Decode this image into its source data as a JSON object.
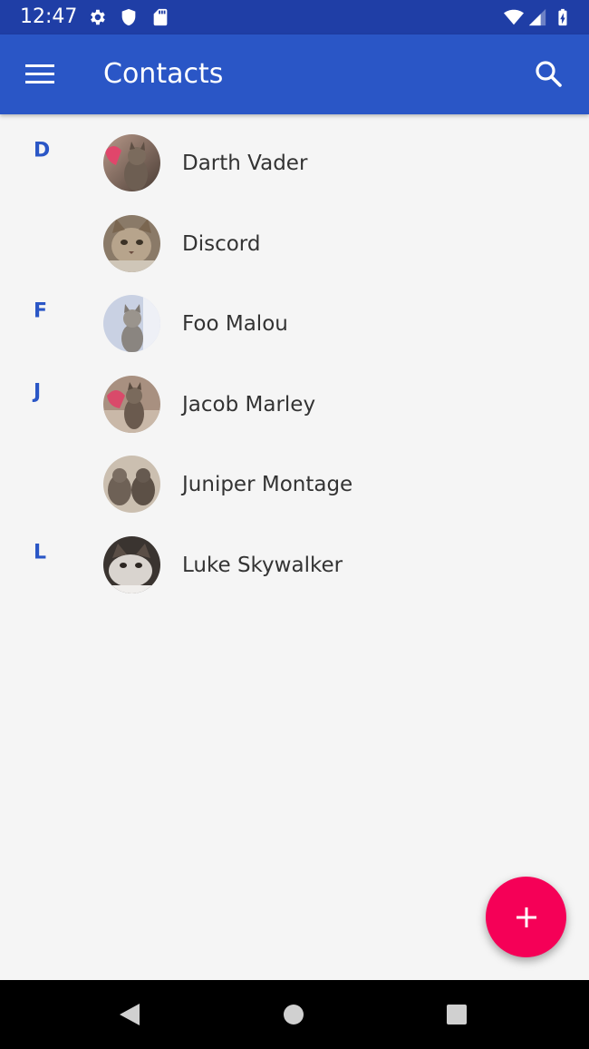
{
  "status_bar": {
    "time": "12:47",
    "icons": [
      "settings-icon",
      "shield-icon",
      "sd-card-icon",
      "wifi-icon",
      "signal-icon",
      "battery-icon"
    ]
  },
  "app_bar": {
    "title": "Contacts",
    "menu_icon": "menu-icon",
    "search_icon": "search-icon",
    "color": "#2a56c6"
  },
  "contacts": [
    {
      "letter": "D",
      "name": "Darth Vader"
    },
    {
      "letter": "",
      "name": "Discord"
    },
    {
      "letter": "F",
      "name": "Foo Malou"
    },
    {
      "letter": "J",
      "name": "Jacob Marley"
    },
    {
      "letter": "",
      "name": "Juniper Montage"
    },
    {
      "letter": "L",
      "name": "Luke Skywalker"
    }
  ],
  "fab": {
    "icon": "add-icon",
    "color": "#f50057"
  },
  "nav_bar": {
    "buttons": [
      "back-icon",
      "home-icon",
      "recents-icon"
    ]
  }
}
